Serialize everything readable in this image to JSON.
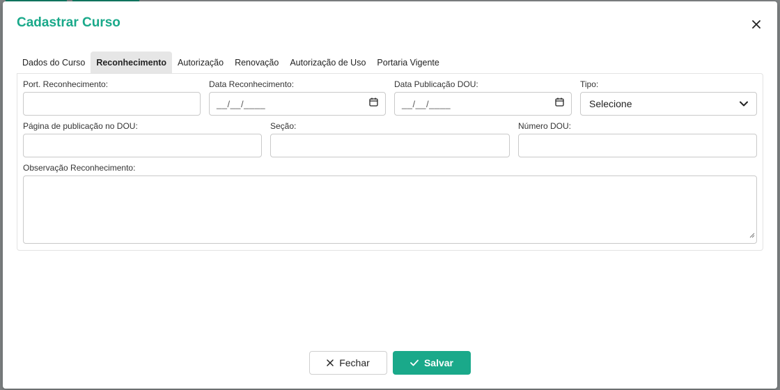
{
  "modal": {
    "title": "Cadastrar Curso"
  },
  "tabs": [
    {
      "label": "Dados do Curso",
      "active": false
    },
    {
      "label": "Reconhecimento",
      "active": true
    },
    {
      "label": "Autorização",
      "active": false
    },
    {
      "label": "Renovação",
      "active": false
    },
    {
      "label": "Autorização de Uso",
      "active": false
    },
    {
      "label": "Portaria Vigente",
      "active": false
    }
  ],
  "form": {
    "port_reconhecimento": {
      "label": "Port. Reconhecimento:",
      "value": ""
    },
    "data_reconhecimento": {
      "label": "Data Reconhecimento:",
      "mask": "__/__/____"
    },
    "data_publicacao_dou": {
      "label": "Data Publicação DOU:",
      "mask": "__/__/____"
    },
    "tipo": {
      "label": "Tipo:",
      "selected": "Selecione"
    },
    "pagina_publicacao": {
      "label": "Página de publicação no DOU:",
      "value": ""
    },
    "secao": {
      "label": "Seção:",
      "value": ""
    },
    "numero_dou": {
      "label": "Número DOU:",
      "value": ""
    },
    "observacao": {
      "label": "Observação Reconhecimento:",
      "value": ""
    }
  },
  "footer": {
    "close_label": "Fechar",
    "save_label": "Salvar"
  },
  "colors": {
    "accent": "#1aa98a",
    "active_tab_bg": "#e6e6e6"
  }
}
